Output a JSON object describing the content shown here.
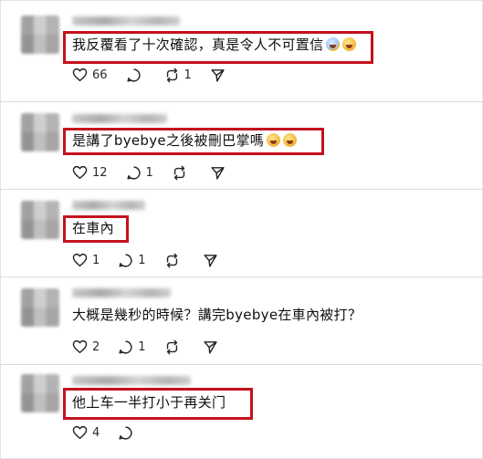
{
  "comments": [
    {
      "text": "我反覆看了十次確認，真是令人不可置信",
      "emojis": [
        "face-screaming-icon",
        "pleading-face-icon"
      ],
      "likes": "66",
      "replies": "",
      "reposts": "1"
    },
    {
      "text": "是講了byebye之後被刪巴掌嗎",
      "emojis": [
        "pleading-face-icon",
        "pleading-face-icon"
      ],
      "likes": "12",
      "replies": "1",
      "reposts": ""
    },
    {
      "text": "在車內",
      "emojis": [],
      "likes": "1",
      "replies": "1",
      "reposts": ""
    },
    {
      "text": "大概是幾秒的時候？講完byebye在車內被打？",
      "emojis": [],
      "likes": "2",
      "replies": "1",
      "reposts": ""
    },
    {
      "text": "他上车一半打小于再关门",
      "emojis": [],
      "likes": "4",
      "replies": "",
      "reposts": ""
    }
  ],
  "colors": {
    "highlight_box": "#c4121c",
    "text": "#101010",
    "divider": "#dcdcdc"
  }
}
